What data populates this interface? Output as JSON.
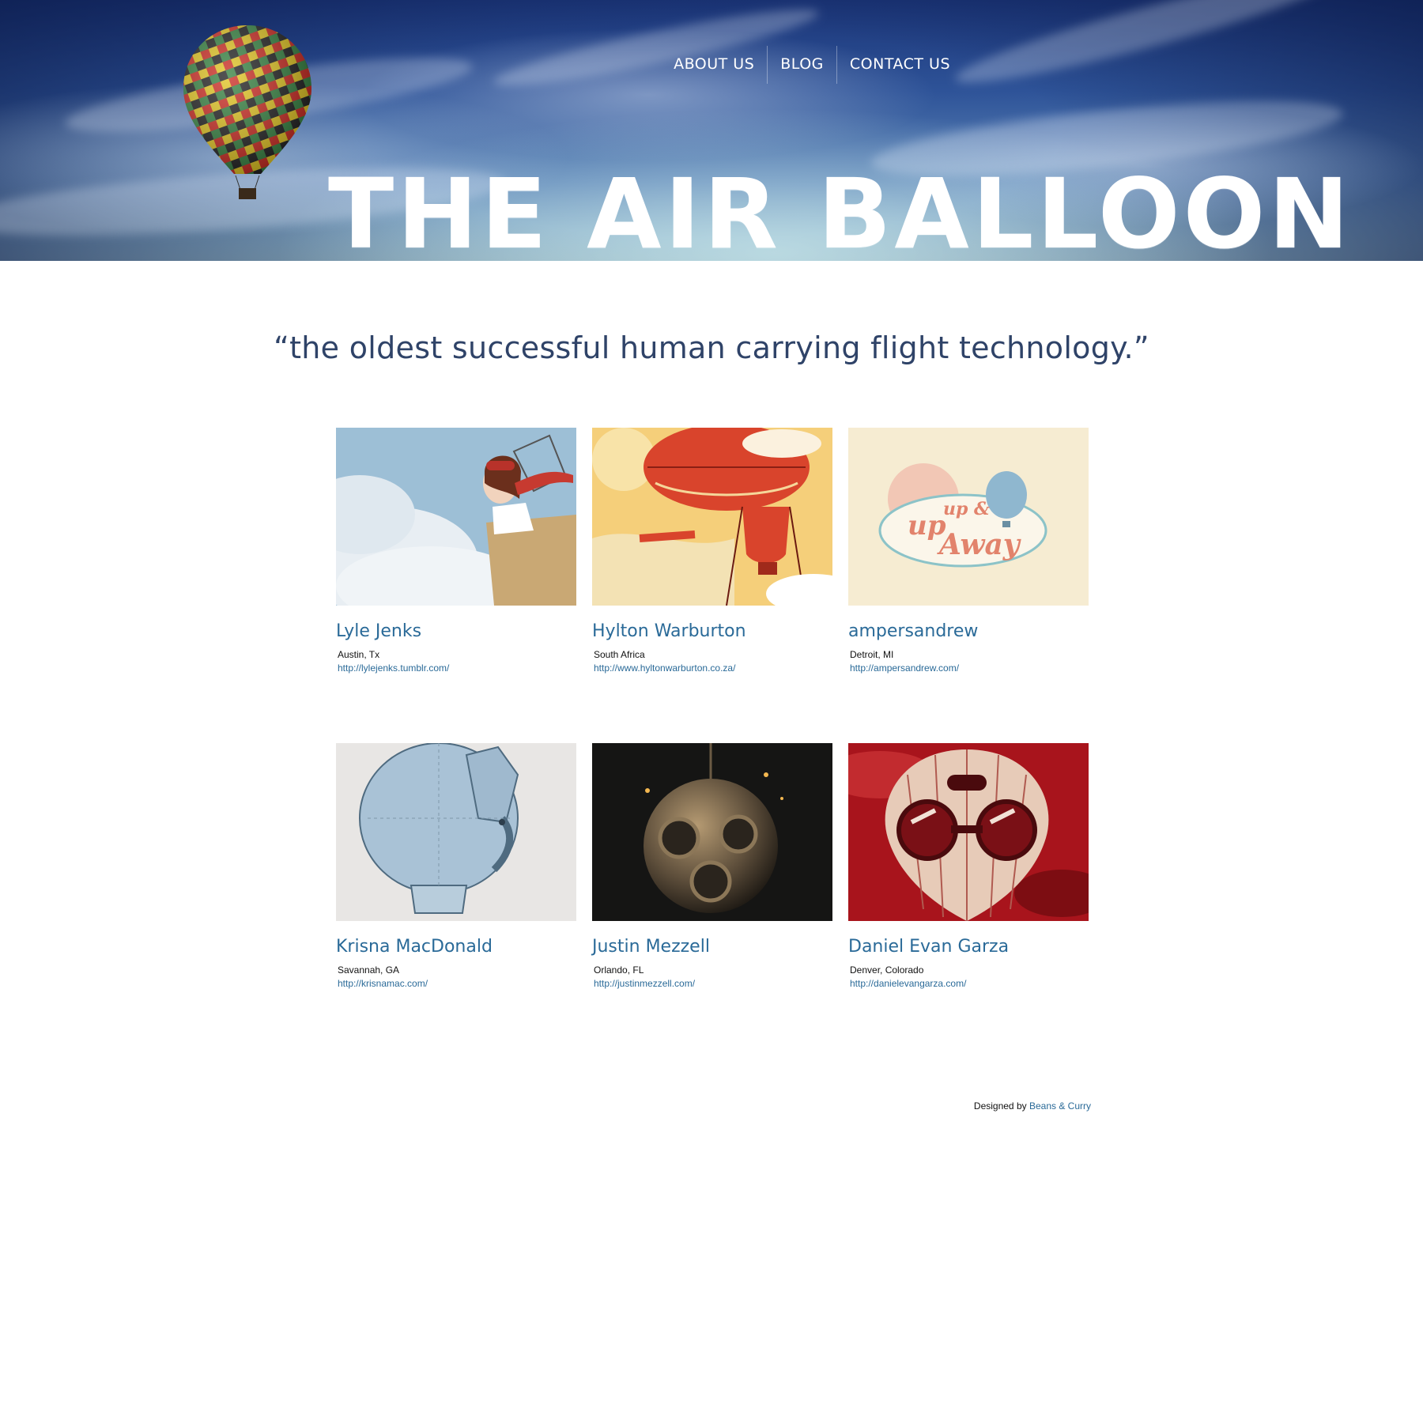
{
  "header": {
    "title": "THE AIR BALLOON",
    "nav": [
      {
        "label": "ABOUT US"
      },
      {
        "label": "BLOG"
      },
      {
        "label": "CONTACT US"
      }
    ]
  },
  "tagline": "“the oldest successful human carrying flight technology.”",
  "artists": [
    {
      "name": "Lyle Jenks",
      "location": "Austin, Tx",
      "url": "http://lylejenks.tumblr.com/"
    },
    {
      "name": "Hylton Warburton",
      "location": "South Africa",
      "url": "http://www.hyltonwarburton.co.za/"
    },
    {
      "name": "ampersandrew",
      "location": "Detroit, MI",
      "url": "http://ampersandrew.com/"
    },
    {
      "name": "Krisna MacDonald",
      "location": "Savannah, GA",
      "url": "http://krisnamac.com/"
    },
    {
      "name": "Justin Mezzell",
      "location": "Orlando, FL",
      "url": "http://justinmezzell.com/"
    },
    {
      "name": "Daniel Evan Garza",
      "location": "Denver, Colorado",
      "url": "http://danielevangarza.com/"
    }
  ],
  "artwork": {
    "thumb3_text_1": "up",
    "thumb3_text_2": "up &",
    "thumb3_text_3": "Away"
  },
  "footer": {
    "prefix": "Designed by",
    "link": "Beans & Curry"
  },
  "colors": {
    "link": "#2a6a98",
    "tagline": "#2f4368",
    "sky_top": "#1b3578",
    "sky_bottom": "#9fc3cf"
  }
}
